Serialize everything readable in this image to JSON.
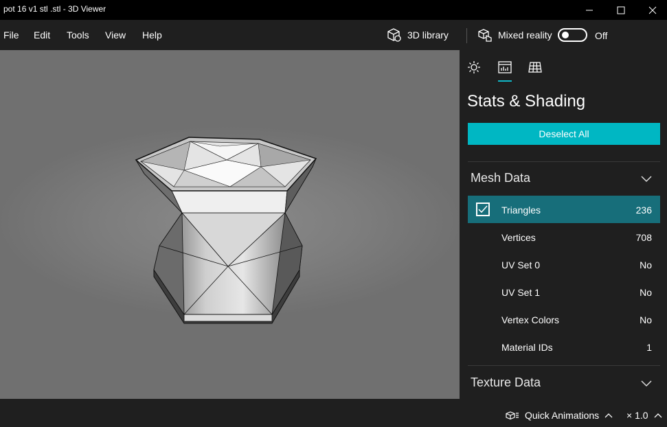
{
  "window": {
    "title": "pot 16  v1 stl .stl - 3D Viewer"
  },
  "menu": {
    "items": [
      "File",
      "Edit",
      "Tools",
      "View",
      "Help"
    ],
    "library_label": "3D library",
    "mixed_reality_label": "Mixed reality",
    "mixed_reality_state": "Off"
  },
  "panel": {
    "tabs": [
      "lighting-icon",
      "stats-icon",
      "grid-icon"
    ],
    "title": "Stats & Shading",
    "deselect_label": "Deselect All",
    "mesh_section": {
      "title": "Mesh Data",
      "rows": [
        {
          "label": "Triangles",
          "value": "236",
          "checked": true
        },
        {
          "label": "Vertices",
          "value": "708"
        },
        {
          "label": "UV Set 0",
          "value": "No"
        },
        {
          "label": "UV Set 1",
          "value": "No"
        },
        {
          "label": "Vertex Colors",
          "value": "No"
        },
        {
          "label": "Material IDs",
          "value": "1"
        }
      ]
    },
    "texture_section": {
      "title": "Texture Data"
    }
  },
  "status": {
    "quick_animations_label": "Quick Animations",
    "speed_label": "× 1.0"
  },
  "colors": {
    "accent": "#00b7c3",
    "selected_row": "#176e7a",
    "panel_bg": "#1f1f1f"
  }
}
